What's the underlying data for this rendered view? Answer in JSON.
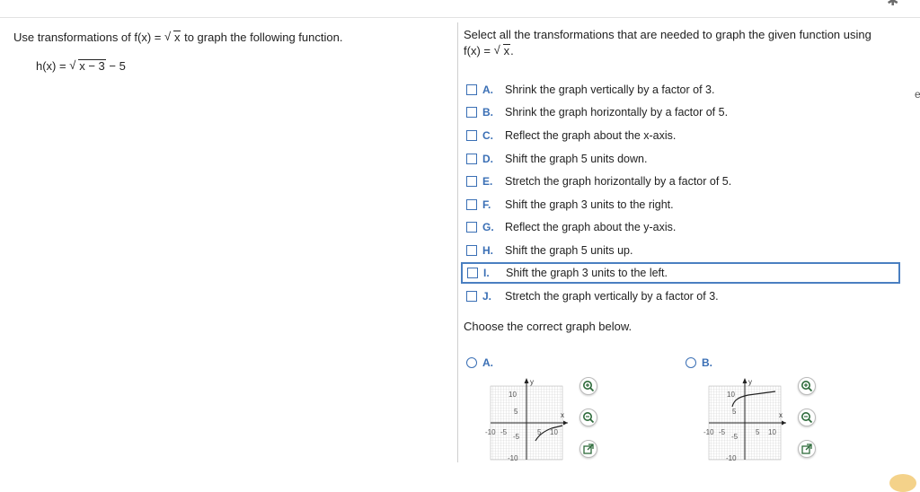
{
  "left": {
    "question_before": "Use transformations of f(x) = ",
    "question_radicand": "x",
    "question_after": " to graph the following function.",
    "function_lhs": "h(x) = ",
    "function_radicand": "x − 3",
    "function_rhs": " − 5"
  },
  "right": {
    "prompt_line1": "Select all the transformations that are needed to graph the given function using",
    "prompt_fx": "f(x) = ",
    "prompt_radicand": "x",
    "prompt_end": ".",
    "options": [
      {
        "letter": "A.",
        "text": "Shrink the graph vertically by a factor of 3."
      },
      {
        "letter": "B.",
        "text": "Shrink the graph horizontally by a factor of 5."
      },
      {
        "letter": "C.",
        "text": "Reflect the graph about the x-axis."
      },
      {
        "letter": "D.",
        "text": "Shift the graph 5 units down."
      },
      {
        "letter": "E.",
        "text": "Stretch the graph horizontally by a factor of 5."
      },
      {
        "letter": "F.",
        "text": "Shift the graph 3 units to the right."
      },
      {
        "letter": "G.",
        "text": "Reflect the graph about the y-axis."
      },
      {
        "letter": "H.",
        "text": "Shift the graph 5 units up."
      },
      {
        "letter": "I.",
        "text": "Shift the graph 3 units to the left."
      },
      {
        "letter": "J.",
        "text": "Stretch the graph vertically by a factor of 3."
      }
    ],
    "choose_label": "Choose the correct graph below.",
    "graph_choices": [
      {
        "letter": "A.",
        "y_label": "y",
        "x_label": "x",
        "ticks": {
          "y_top": "10",
          "y_mid": "5",
          "y_neg": "-5",
          "y_bottom": "-10",
          "x_left": "-10",
          "x_neg": "-5",
          "x_pos": "5",
          "x_right": "10"
        }
      },
      {
        "letter": "B.",
        "y_label": "y",
        "x_label": "x",
        "ticks": {
          "y_top": "10",
          "y_mid": "5",
          "y_neg": "-5",
          "y_bottom": "-10",
          "x_left": "-10",
          "x_neg": "-5",
          "x_pos": "5",
          "x_right": "10"
        }
      }
    ]
  },
  "icons": {
    "settings": "gear-icon",
    "zoom_in": "zoom-in-icon",
    "zoom_out": "zoom-out-icon",
    "popout": "popout-icon"
  },
  "colors": {
    "accent": "#3a6fb5",
    "selected_border": "#4a7fc1"
  }
}
